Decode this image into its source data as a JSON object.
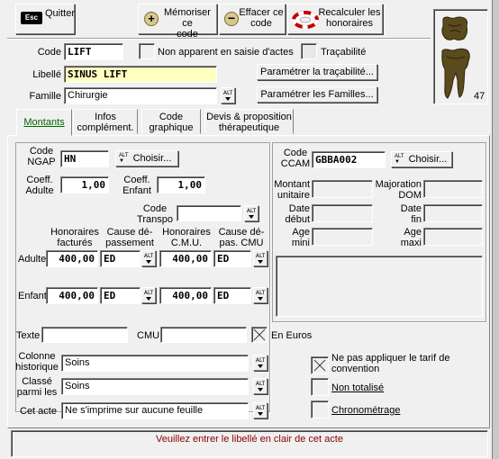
{
  "toolbar": {
    "quit_icon": "Esc",
    "quit_label": "Quitter",
    "memorize_label_1": "Mémoriser ce",
    "memorize_label_2": "code",
    "erase_label_1": "Effacer ce",
    "erase_label_2": "code",
    "recalc_label_1": "Recalculer les",
    "recalc_label_2": "honoraires"
  },
  "tooth_panel": {
    "number": "47"
  },
  "form": {
    "code_label": "Code",
    "code_value": "LIFT",
    "non_apparent_label": "Non apparent en saisie d'actes",
    "tracabilite_label": "Traçabilité",
    "libelle_label": "Libellé",
    "libelle_value": "SINUS LIFT",
    "param_tracabilite_button": "Paramétrer la traçabilité...",
    "famille_label": "Famille",
    "famille_value": "Chirurgie",
    "param_familles_button": "Paramétrer les Familles..."
  },
  "tabs": [
    {
      "label": "Montants"
    },
    {
      "label_1": "Infos",
      "label_2": "complément."
    },
    {
      "label_1": "Code",
      "label_2": "graphique"
    },
    {
      "label_1": "Devis & proposition",
      "label_2": "thérapeutique"
    }
  ],
  "montants": {
    "ngap_label_1": "Code",
    "ngap_label_2": "NGAP",
    "ngap_value": "HN",
    "choisir_label": "Choisir...",
    "coeff_adulte_label_1": "Coeff.",
    "coeff_adulte_label_2": "Adulte",
    "coeff_adulte_value": "1,00",
    "coeff_enfant_label_1": "Coeff.",
    "coeff_enfant_label_2": "Enfant",
    "coeff_enfant_value": "1,00",
    "transpo_label_1": "Code",
    "transpo_label_2": "Transpo",
    "col_hon_fact_1": "Honoraires",
    "col_hon_fact_2": "facturés",
    "col_cause_dep_1": "Cause dé-",
    "col_cause_dep_2": "passement",
    "col_hon_cmu_1": "Honoraires",
    "col_hon_cmu_2": "C.M.U.",
    "col_cause_cmu_1": "Cause dé-",
    "col_cause_cmu_2": "pas. CMU",
    "adulte_label": "Adulte",
    "adulte_hon": "400,00",
    "adulte_cause": "ED",
    "adulte_cmu": "400,00",
    "adulte_cause_cmu": "ED",
    "enfant_label": "Enfant",
    "enfant_hon": "400,00",
    "enfant_cause": "ED",
    "enfant_cmu": "400,00",
    "enfant_cause_cmu": "ED",
    "texte_label": "Texte",
    "cmu_label": "CMU",
    "en_euros_label": "En Euros"
  },
  "ccam": {
    "code_label_1": "Code",
    "code_label_2": "CCAM",
    "code_value": "GBBA002",
    "choisir_label": "Choisir...",
    "montant_label_1": "Montant",
    "montant_label_2": "unitaire",
    "majoration_label_1": "Majoration",
    "majoration_label_2": "DOM",
    "date_debut_label_1": "Date",
    "date_debut_label_2": "début",
    "date_fin_label_1": "Date",
    "date_fin_label_2": "fin",
    "age_mini_label_1": "Age",
    "age_mini_label_2": "mini",
    "age_maxi_label_1": "Age",
    "age_maxi_label_2": "maxi"
  },
  "bottom": {
    "colonne_label_1": "Colonne",
    "colonne_label_2": "historique",
    "colonne_value": "Soins",
    "classe_label_1": "Classé",
    "classe_label_2": "parmi les",
    "classe_value": "Soins",
    "cet_acte_label": "Cet acte",
    "cet_acte_value": "Ne s'imprime sur aucune feuille",
    "ne_pas_appliquer_1": "Ne pas appliquer le tarif de",
    "ne_pas_appliquer_2": "convention",
    "non_totalise": "Non totalisé",
    "chronometrage": "Chronométrage"
  },
  "status": {
    "message": "Veuillez entrer le libellé en clair de cet acte",
    "color": "#8b0000"
  }
}
